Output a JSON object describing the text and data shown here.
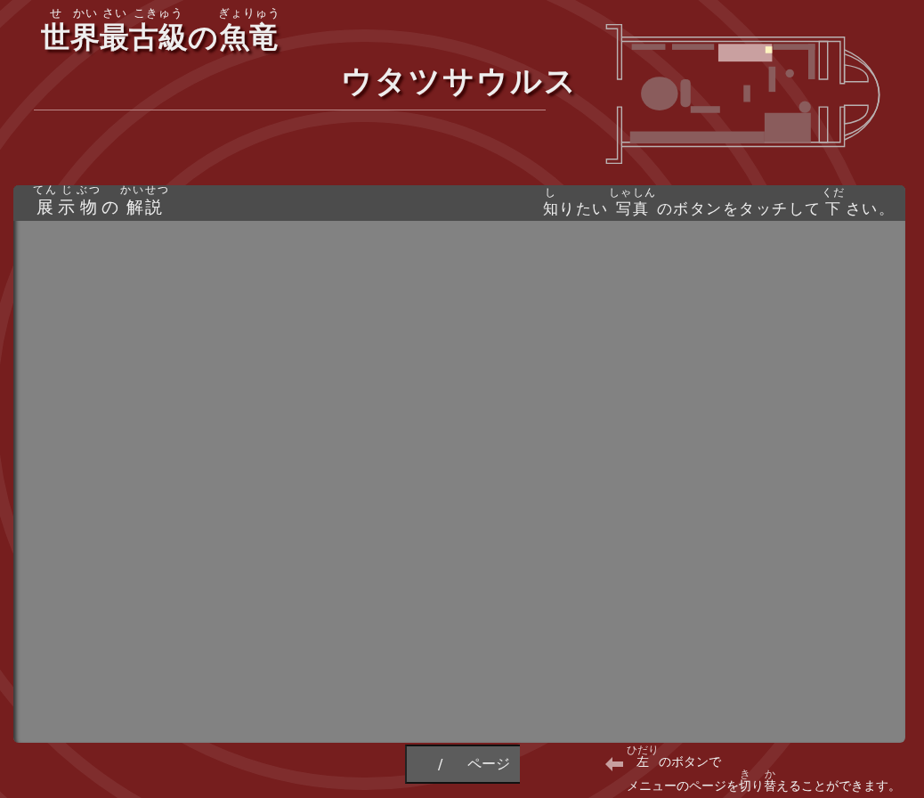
{
  "title": {
    "line_1": [
      {
        "text": "世",
        "ruby": "せ"
      },
      {
        "text": "界",
        "ruby": "かい"
      },
      {
        "text": "最",
        "ruby": "さい"
      },
      {
        "text": "古級",
        "ruby": "こきゅう"
      },
      {
        "text": "の"
      },
      {
        "text": "魚竜",
        "ruby": "ぎょりゅう"
      }
    ],
    "line_2": "ウタツサウルス"
  },
  "panel": {
    "heading": [
      {
        "text": "展",
        "ruby": "てん"
      },
      {
        "text": "示",
        "ruby": "じ"
      },
      {
        "text": "物",
        "ruby": "ぶつ"
      },
      {
        "text": "の"
      },
      {
        "text": "解説",
        "ruby": "かいせつ"
      }
    ],
    "instruction": [
      {
        "text": "知",
        "ruby": "し"
      },
      {
        "text": "りたい"
      },
      {
        "text": "写真",
        "ruby": "しゃしん"
      },
      {
        "text": "のボタンをタッチして"
      },
      {
        "text": "下",
        "ruby": "くだ"
      },
      {
        "text": "さい。"
      }
    ]
  },
  "pager": {
    "separator": "/",
    "unit": "ページ"
  },
  "hint": {
    "line_1": [
      {
        "text": "左",
        "ruby": "ひだり"
      },
      {
        "text": "のボタンで"
      }
    ],
    "line_2": [
      {
        "text": "メニューのページを"
      },
      {
        "text": "切",
        "ruby": "き"
      },
      {
        "text": "り"
      },
      {
        "text": "替",
        "ruby": "か"
      },
      {
        "text": "えることができます。"
      }
    ]
  }
}
